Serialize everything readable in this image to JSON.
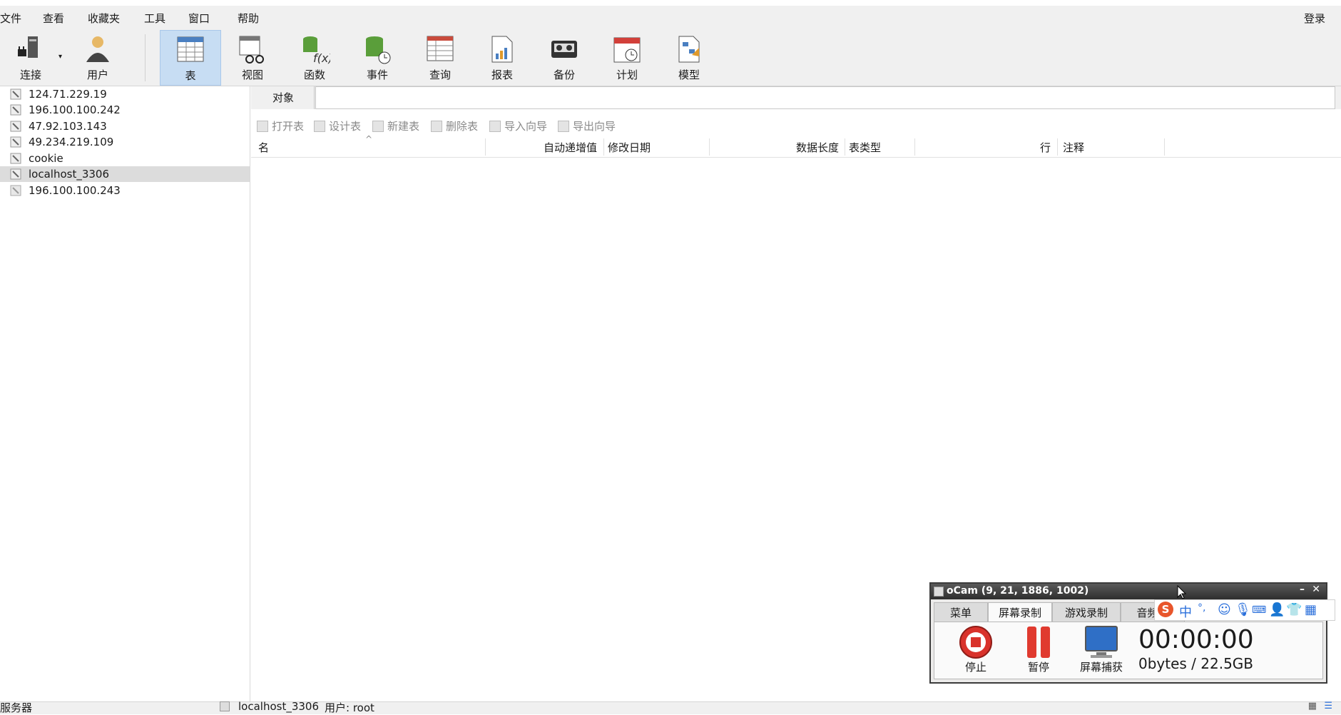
{
  "menu": {
    "items": [
      "文件",
      "查看",
      "收藏夹",
      "工具",
      "窗口",
      "帮助"
    ],
    "login": "登录"
  },
  "toolbar": {
    "items": [
      {
        "label": "连接",
        "icon": "plug-icon"
      },
      {
        "label": "用户",
        "icon": "user-icon"
      },
      {
        "label": "表",
        "icon": "table-icon",
        "active": true
      },
      {
        "label": "视图",
        "icon": "view-icon"
      },
      {
        "label": "函数",
        "icon": "function-icon"
      },
      {
        "label": "事件",
        "icon": "event-icon"
      },
      {
        "label": "查询",
        "icon": "query-icon"
      },
      {
        "label": "报表",
        "icon": "report-icon"
      },
      {
        "label": "备份",
        "icon": "backup-icon"
      },
      {
        "label": "计划",
        "icon": "schedule-icon"
      },
      {
        "label": "模型",
        "icon": "model-icon"
      }
    ]
  },
  "connections": [
    {
      "name": "124.71.229.19"
    },
    {
      "name": "196.100.100.242"
    },
    {
      "name": "47.92.103.143"
    },
    {
      "name": "49.234.219.109"
    },
    {
      "name": "cookie"
    },
    {
      "name": "localhost_3306",
      "selected": true
    },
    {
      "name": "196.100.100.243"
    }
  ],
  "objects_tab": {
    "label": "对象"
  },
  "actions": [
    "打开表",
    "设计表",
    "新建表",
    "删除表",
    "导入向导",
    "导出向导"
  ],
  "columns": [
    "名",
    "自动递增值",
    "修改日期",
    "数据长度",
    "表类型",
    "行",
    "注释"
  ],
  "status": {
    "left": "服务器",
    "connection": "localhost_3306",
    "user": "用户: root"
  },
  "ocam": {
    "title": "oCam (9, 21, 1886, 1002)",
    "tabs": [
      "菜单",
      "屏幕录制",
      "游戏录制",
      "音频录"
    ],
    "active_tab": "屏幕录制",
    "buttons": [
      {
        "label": "停止",
        "icon": "stop-icon"
      },
      {
        "label": "暂停",
        "icon": "pause-icon"
      },
      {
        "label": "屏幕捕获",
        "icon": "monitor-icon"
      }
    ],
    "timer": "00:00:00",
    "size": "0bytes / 22.5GB"
  },
  "ime": {
    "chars": [
      "中",
      "°,"
    ]
  }
}
